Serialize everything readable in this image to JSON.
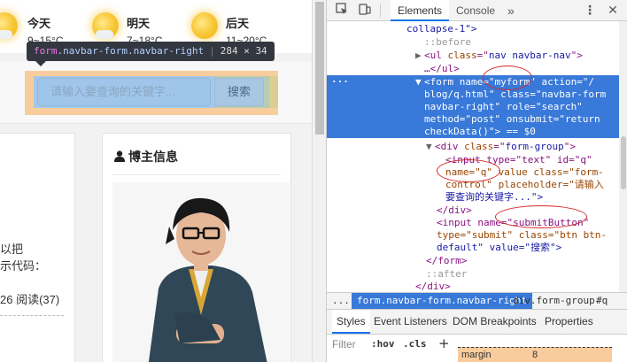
{
  "weather": [
    {
      "day": "今天",
      "temp": "9~15°C"
    },
    {
      "day": "明天",
      "temp": "7~18°C"
    },
    {
      "day": "后天",
      "temp": "11~20°C"
    }
  ],
  "tooltip": {
    "tag": "form",
    "classes": ".navbar-form.navbar-right",
    "size": "284 × 34"
  },
  "search": {
    "placeholder": "请输入要查询的关键字...",
    "button": "搜索"
  },
  "left_panel": {
    "line1": "以把",
    "line2": "示代码：",
    "meta": "26 阅读(37)"
  },
  "blogger": {
    "title": "博主信息",
    "icon": "user-icon"
  },
  "devtools": {
    "tabs": [
      "Elements",
      "Console"
    ],
    "active_tab": "Elements",
    "more": "»",
    "dom": {
      "l1": "collapse-1\">",
      "l2": "::before",
      "l3a": "<ul ",
      "l3b": "class",
      "l3c": "=\"",
      "l3d": "nav navbar-nav",
      "l3e": "\">",
      "l4": "…</ul>",
      "sel1": "<form name=\"myform\" action=\"/",
      "sel2": "blog/q.html\" class=\"navbar-form",
      "sel3": "navbar-right\" role=\"search\"",
      "sel4": "method=\"post\" onsubmit=\"return",
      "sel5": "checkData()\"> == $0",
      "l6a": "<div ",
      "l6b": "class",
      "l6c": "=\"",
      "l6d": "form-group",
      "l6e": "\">",
      "l7": "<input type=\"text\" id=\"q\"",
      "l8": "name=\"q\" value class=\"form-",
      "l9": "control\" placeholder=\"请输入",
      "l10": "要查询的关键字...\">",
      "l11": "</div>",
      "l12": "<input name=\"submitButton\"",
      "l13": "type=\"submit\" class=\"btn btn-",
      "l14": "default\" value=\"搜索\">",
      "l15": "</form>",
      "l16": "::after",
      "l17": "</div>"
    },
    "breadcrumbs": {
      "c0": "...",
      "c1": "form.navbar-form.navbar-right",
      "c2": "div.form-group",
      "c3": "#q"
    },
    "subtabs": [
      "Styles",
      "Event Listeners",
      "DOM Breakpoints",
      "Properties"
    ],
    "filter": {
      "placeholder": "Filter",
      "hov": ":hov",
      "cls": ".cls",
      "add": "+"
    },
    "box_model": {
      "label": "margin",
      "value": "8"
    }
  },
  "colors": {
    "selection": "#3879d9",
    "tab_underline": "#1a73e8",
    "annotation": "#d42a2a",
    "highlight_margin": "#f9cc9d",
    "highlight_content": "#a6c8e6"
  }
}
